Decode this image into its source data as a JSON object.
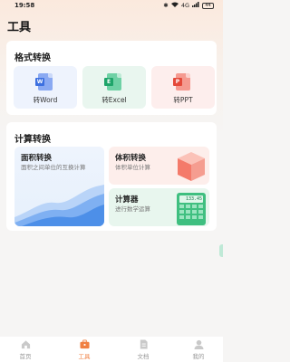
{
  "status_bar": {
    "time": "19:58",
    "signal": "4G",
    "battery": "44"
  },
  "page": {
    "title": "工具"
  },
  "format_section": {
    "title": "格式转换",
    "items": [
      {
        "label": "转Word",
        "icon": "word-file-icon",
        "letter": "W"
      },
      {
        "label": "转Excel",
        "icon": "excel-file-icon",
        "letter": "E"
      },
      {
        "label": "转PPT",
        "icon": "ppt-file-icon",
        "letter": "P"
      }
    ]
  },
  "calc_section": {
    "title": "计算转换",
    "area": {
      "title": "面积转换",
      "subtitle": "面积之间单位的互换计算"
    },
    "volume": {
      "title": "体积转换",
      "subtitle": "体积单位计算"
    },
    "calculator": {
      "title": "计算器",
      "subtitle": "进行数学运算",
      "display": "133.45"
    }
  },
  "tab_bar": {
    "active": "工具",
    "items": [
      {
        "label": "首页",
        "icon": "home-icon"
      },
      {
        "label": "工具",
        "icon": "toolbox-icon"
      },
      {
        "label": "文档",
        "icon": "document-icon"
      },
      {
        "label": "我的",
        "icon": "user-icon"
      }
    ]
  },
  "colors": {
    "accent": "#f07f42",
    "background": "#f6f5f4"
  }
}
